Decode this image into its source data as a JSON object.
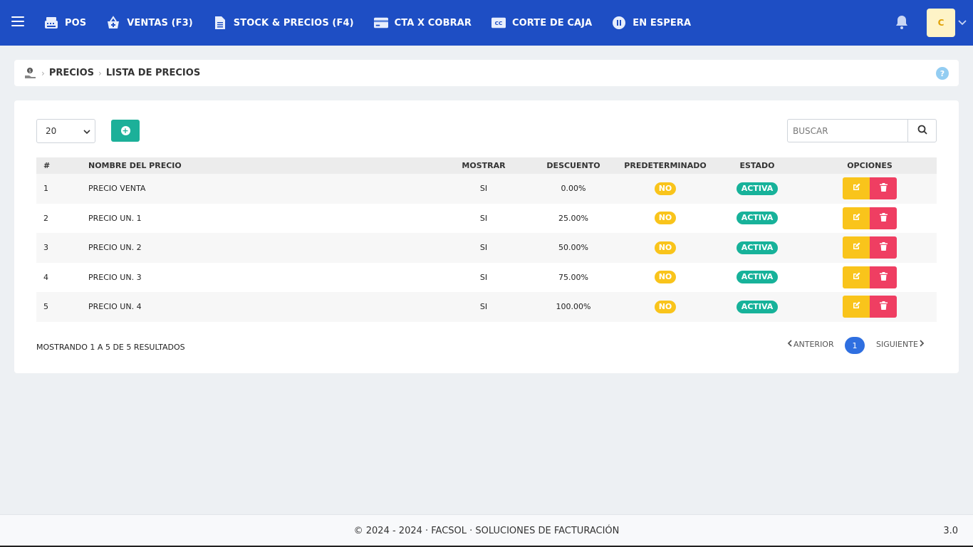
{
  "topbar": {
    "nav": [
      {
        "label": "POS",
        "icon": "cash-register-icon"
      },
      {
        "label": "VENTAS (F3)",
        "icon": "basket-add-icon"
      },
      {
        "label": "STOCK & PRECIOS (F4)",
        "icon": "document-icon"
      },
      {
        "label": "CTA X COBRAR",
        "icon": "credit-card-icon"
      },
      {
        "label": "CORTE DE CAJA",
        "icon": "cc-icon"
      },
      {
        "label": "EN ESPERA",
        "icon": "pause-icon"
      }
    ],
    "avatar_initial": "C",
    "brand_color": "#1e4ec4"
  },
  "breadcrumb": {
    "section": "PRECIOS",
    "current": "LISTA DE PRECIOS",
    "help": "?"
  },
  "controls": {
    "per_page": "20",
    "search_placeholder": "BUSCAR"
  },
  "table": {
    "headers": {
      "num": "#",
      "name": "NOMBRE DEL PRECIO",
      "mostrar": "MOSTRAR",
      "descuento": "DESCUENTO",
      "predeterminado": "PREDETERMINADO",
      "estado": "ESTADO",
      "opciones": "OPCIONES"
    },
    "rows": [
      {
        "num": "1",
        "name": "PRECIO VENTA",
        "mostrar": "SI",
        "descuento": "0.00%",
        "predeterminado": "NO",
        "estado": "ACTIVA"
      },
      {
        "num": "2",
        "name": "PRECIO UN. 1",
        "mostrar": "SI",
        "descuento": "25.00%",
        "predeterminado": "NO",
        "estado": "ACTIVA"
      },
      {
        "num": "3",
        "name": "PRECIO UN. 2",
        "mostrar": "SI",
        "descuento": "50.00%",
        "predeterminado": "NO",
        "estado": "ACTIVA"
      },
      {
        "num": "4",
        "name": "PRECIO UN. 3",
        "mostrar": "SI",
        "descuento": "75.00%",
        "predeterminado": "NO",
        "estado": "ACTIVA"
      },
      {
        "num": "5",
        "name": "PRECIO UN. 4",
        "mostrar": "SI",
        "descuento": "100.00%",
        "predeterminado": "NO",
        "estado": "ACTIVA"
      }
    ]
  },
  "pagination": {
    "showing": "MOSTRANDO 1 A 5 DE 5 RESULTADOS",
    "prev": "ANTERIOR",
    "page": "1",
    "next": "SIGUIENTE"
  },
  "footer": {
    "text": "© 2024 - 2024 · FACSOL · SOLUCIONES DE FACTURACIÓN",
    "version": "3.0"
  }
}
